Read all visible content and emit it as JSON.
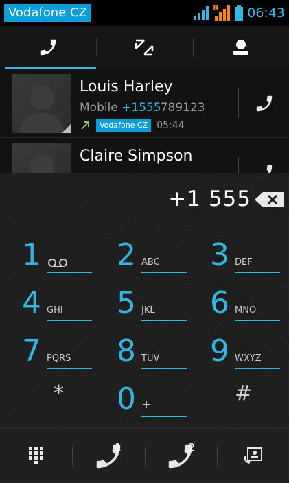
{
  "statusbar": {
    "carrier": "Vodafone CZ",
    "roaming_label": "R",
    "time": "06:43"
  },
  "tabs": [
    {
      "name": "phone-tab-icon",
      "active": true
    },
    {
      "name": "call-log-tab-icon",
      "active": false
    },
    {
      "name": "contacts-tab-icon",
      "active": false
    }
  ],
  "calllog": [
    {
      "name": "Louis Harley",
      "number_type": "Mobile",
      "number_match": "+1555",
      "number_rest": "789123",
      "network": "Vodafone CZ",
      "time": "05:44"
    },
    {
      "name": "Claire Simpson"
    }
  ],
  "dialer": {
    "digits": "+1 555"
  },
  "keypad": [
    {
      "digit": "1",
      "letters": ""
    },
    {
      "digit": "2",
      "letters": "ABC"
    },
    {
      "digit": "3",
      "letters": "DEF"
    },
    {
      "digit": "4",
      "letters": "GHI"
    },
    {
      "digit": "5",
      "letters": "JKL"
    },
    {
      "digit": "6",
      "letters": "MNO"
    },
    {
      "digit": "7",
      "letters": "PQRS"
    },
    {
      "digit": "8",
      "letters": "TUV"
    },
    {
      "digit": "9",
      "letters": "WXYZ"
    },
    {
      "digit": "*",
      "letters": ""
    },
    {
      "digit": "0",
      "letters": "+"
    },
    {
      "digit": "#",
      "letters": ""
    }
  ],
  "bottombar": {
    "sim1_label": "1",
    "sim2_label": "2"
  },
  "colors": {
    "accent": "#33b5e5",
    "carrier_badge": "#0a9fd8"
  }
}
